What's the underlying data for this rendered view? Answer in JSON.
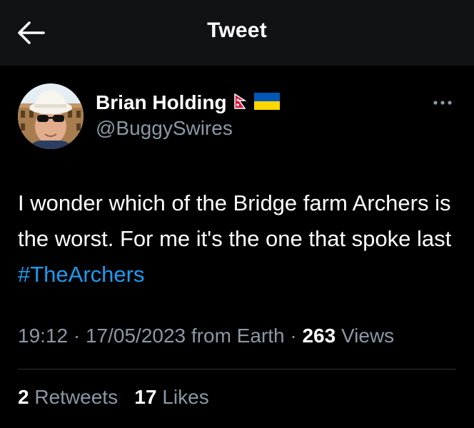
{
  "header": {
    "title": "Tweet",
    "back_icon": "arrow-left-icon"
  },
  "author": {
    "name": "Brian Holding",
    "handle": "@BuggySwires",
    "flags": [
      "nepal-flag-icon",
      "ukraine-flag-icon"
    ],
    "avatar": "avatar"
  },
  "tweet": {
    "text_prefix": "I wonder which of the Bridge farm Archers is the worst. For me it's the one that spoke last ",
    "hashtag": "#TheArchers"
  },
  "meta": {
    "time": "19:12",
    "separator": "·",
    "date": "17/05/2023",
    "source": "from Earth",
    "views_count": "263",
    "views_label": "Views"
  },
  "stats": {
    "retweets_count": "2",
    "retweets_label": "Retweets",
    "likes_count": "17",
    "likes_label": "Likes"
  },
  "colors": {
    "background": "#000000",
    "header_background": "#111214",
    "text": "#ffffff",
    "secondary_text": "#8b98a5",
    "link": "#1d9bf0",
    "divider": "#2f3336"
  },
  "more_icon": "more-horizontal-icon"
}
